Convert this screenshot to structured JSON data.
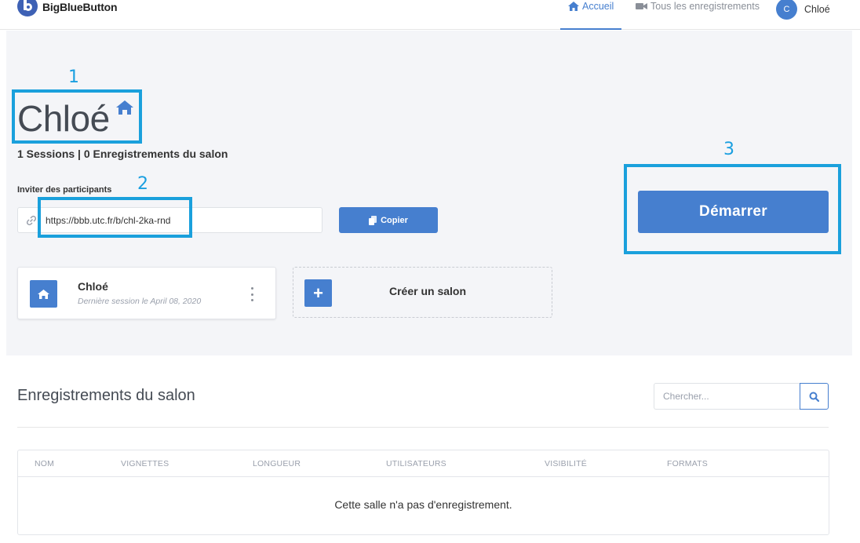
{
  "brand": {
    "name": "BigBlueButton"
  },
  "nav": {
    "home_label": "Accueil",
    "recordings_label": "Tous les enregistrements",
    "user_initial": "C",
    "user_name": "Chloé"
  },
  "annotations": {
    "n1": "1",
    "n2": "2",
    "n3": "3"
  },
  "room": {
    "title": "Chloé",
    "stats": "1 Sessions | 0 Enregistrements du salon",
    "invite_label": "Inviter des participants",
    "invite_url": "https://bbb.utc.fr/b/chl-2ka-rnd",
    "copy_label": "Copier",
    "start_label": "Démarrer"
  },
  "rooms_list": [
    {
      "name": "Chloé",
      "last_session": "Dernière session le April 08, 2020"
    }
  ],
  "create_room_label": "Créer un salon",
  "recordings": {
    "title": "Enregistrements du salon",
    "search_placeholder": "Chercher...",
    "columns": [
      "NOM",
      "VIGNETTES",
      "LONGUEUR",
      "UTILISATEURS",
      "VISIBILITÉ",
      "FORMATS"
    ],
    "empty_message": "Cette salle n'a pas d'enregistrement."
  },
  "colors": {
    "primary": "#467fcf",
    "annotation": "#1aa0dc",
    "hero_bg": "#f4f5f8"
  }
}
